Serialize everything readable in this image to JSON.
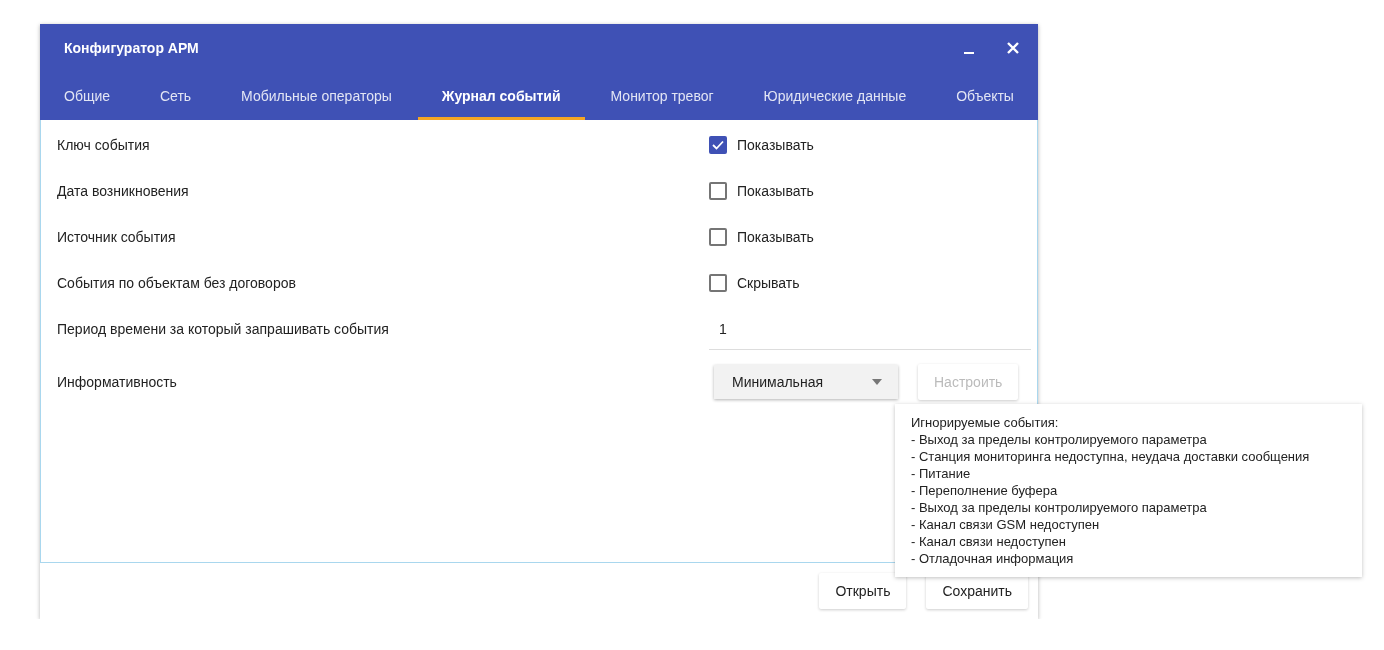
{
  "window": {
    "title": "Конфигуратор АРМ"
  },
  "tabs": [
    {
      "label": "Общие",
      "selected": false
    },
    {
      "label": "Сеть",
      "selected": false
    },
    {
      "label": "Мобильные операторы",
      "selected": false
    },
    {
      "label": "Журнал событий",
      "selected": true
    },
    {
      "label": "Монитор тревог",
      "selected": false
    },
    {
      "label": "Юридические данные",
      "selected": false
    },
    {
      "label": "Объекты",
      "selected": false
    }
  ],
  "settings": [
    {
      "kind": "checkbox",
      "label": "Ключ события",
      "option": "Показывать",
      "checked": true
    },
    {
      "kind": "checkbox",
      "label": "Дата возникновения",
      "option": "Показывать",
      "checked": false
    },
    {
      "kind": "checkbox",
      "label": "Источник события",
      "option": "Показывать",
      "checked": false
    },
    {
      "kind": "checkbox",
      "label": "События по объектам без договоров",
      "option": "Скрывать",
      "checked": false
    },
    {
      "kind": "text",
      "label": "Период времени за который запрашивать события",
      "value": "1"
    },
    {
      "kind": "select",
      "label": "Информативность",
      "value": "Минимальная",
      "button": {
        "label": "Настроить",
        "disabled": true
      }
    }
  ],
  "tooltip": {
    "title": "Игнорируемые события:",
    "lines": [
      "- Выход за пределы контролируемого параметра",
      "- Станция мониторинга недоступна, неудача доставки сообщения",
      "- Питание",
      "- Переполнение буфера",
      "- Выход за пределы контролируемого параметра",
      "- Канал связи GSM недоступен",
      "- Канал связи недоступен",
      "- Отладочная информация"
    ]
  },
  "footer_buttons": [
    "Открыть",
    "Сохранить"
  ]
}
